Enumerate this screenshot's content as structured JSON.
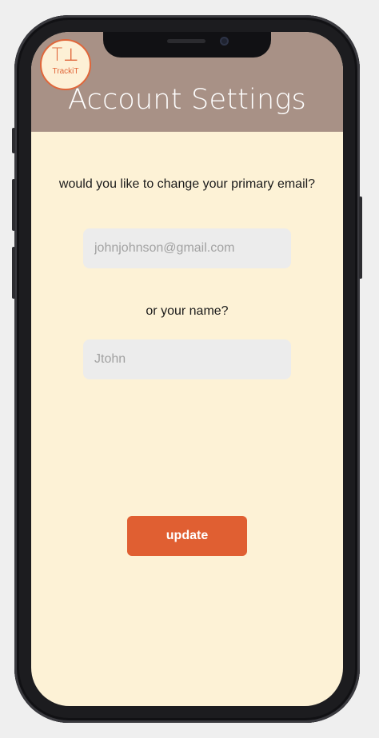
{
  "header": {
    "title": "Account Settings",
    "logo_mark": "T⊥",
    "logo_text": "TrackiT",
    "bg_color": "#a89186"
  },
  "email_section": {
    "prompt": "would you like to change your primary email?",
    "placeholder": "johnjohnson@gmail.com"
  },
  "name_section": {
    "prompt": "or your name?",
    "placeholder": "Jtohn"
  },
  "actions": {
    "update_label": "update",
    "accent_color": "#e05f32"
  },
  "theme": {
    "background_color": "#fdf2d6",
    "field_color": "#ececec"
  }
}
